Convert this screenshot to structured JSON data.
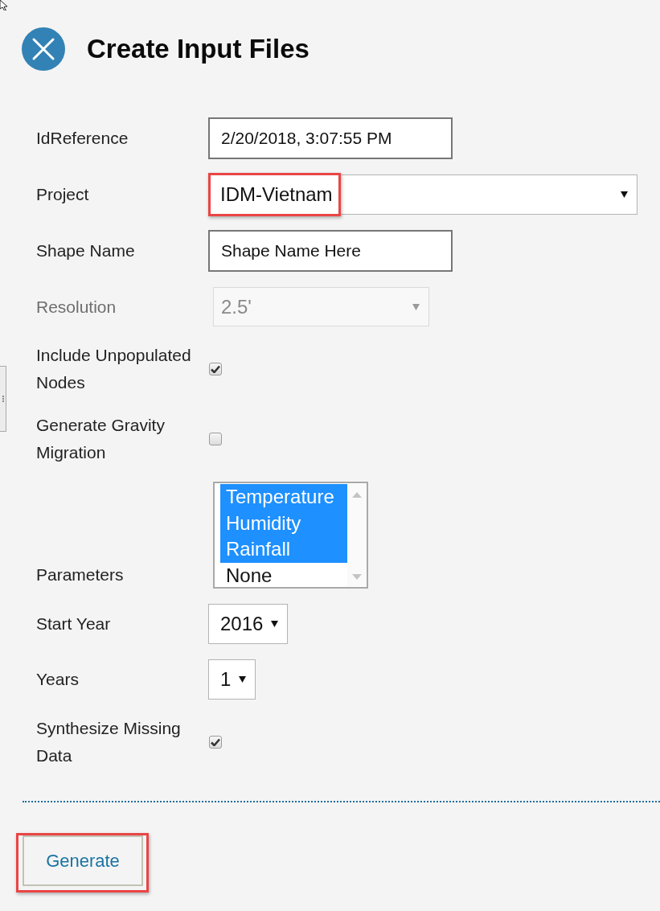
{
  "header": {
    "title": "Create Input Files"
  },
  "fields": [
    {
      "kind": "text",
      "label": "IdReference",
      "value": "2/20/2018, 3:07:55 PM",
      "disabled": false
    },
    {
      "kind": "select",
      "label": "Project",
      "value": "IDM-Vietnam",
      "disabled": false,
      "highlighted": true
    },
    {
      "kind": "text",
      "label": "Shape Name",
      "value": "Shape Name Here",
      "disabled": false
    },
    {
      "kind": "select",
      "label": "Resolution",
      "value": "2.5'",
      "disabled": true
    },
    {
      "kind": "checkbox",
      "label": "Include Unpopulated Nodes",
      "checked": true,
      "disabled": false
    },
    {
      "kind": "checkbox",
      "label": "Generate Gravity Migration",
      "checked": false,
      "disabled": false
    },
    {
      "kind": "listbox",
      "label": "Parameters",
      "disabled": false,
      "options": [
        {
          "label": "Temperature",
          "selected": true
        },
        {
          "label": "Humidity",
          "selected": true
        },
        {
          "label": "Rainfall",
          "selected": true
        },
        {
          "label": "None",
          "selected": false
        }
      ]
    },
    {
      "kind": "select",
      "label": "Start Year",
      "value": "2016",
      "disabled": false
    },
    {
      "kind": "select",
      "label": "Years",
      "value": "1",
      "disabled": false
    },
    {
      "kind": "checkbox",
      "label": "Synthesize Missing Data",
      "checked": true,
      "disabled": false
    }
  ],
  "generate_button": {
    "label": "Generate",
    "highlighted": true
  }
}
